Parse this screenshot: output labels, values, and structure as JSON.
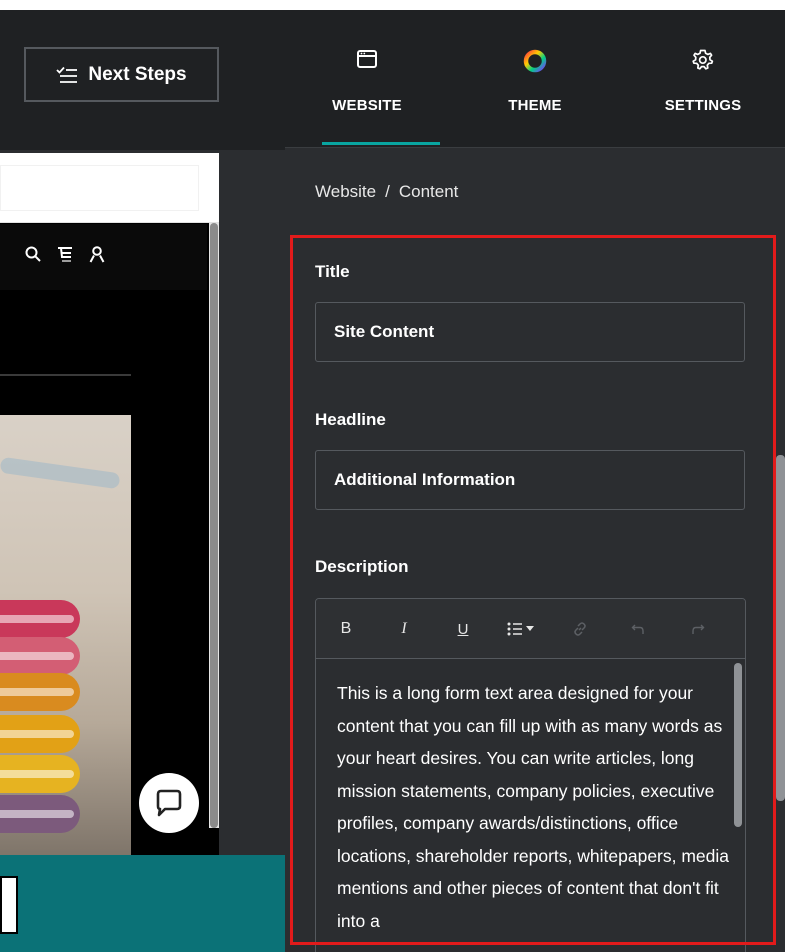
{
  "topbar": {
    "next_steps_label": "Next Steps"
  },
  "preview": {
    "icons": [
      "search-icon",
      "cart-icon",
      "user-icon"
    ],
    "chat_icon": "chat-icon"
  },
  "panel": {
    "tabs": [
      {
        "label": "WEBSITE",
        "icon": "browser-window-icon",
        "active": true
      },
      {
        "label": "THEME",
        "icon": "color-wheel-icon",
        "active": false
      },
      {
        "label": "SETTINGS",
        "icon": "gear-icon",
        "active": false
      }
    ],
    "breadcrumb": {
      "root": "Website",
      "separator": "/",
      "current": "Content"
    },
    "fields": {
      "title": {
        "label": "Title",
        "value": "Site Content"
      },
      "headline": {
        "label": "Headline",
        "value": "Additional Information"
      },
      "description": {
        "label": "Description",
        "toolbar": [
          {
            "label": "B",
            "name": "bold-button",
            "enabled": true
          },
          {
            "label": "I",
            "name": "italic-button",
            "enabled": true
          },
          {
            "label": "U",
            "name": "underline-button",
            "enabled": true
          },
          {
            "label": "list",
            "name": "list-dropdown-button",
            "enabled": true
          },
          {
            "label": "link",
            "name": "link-button",
            "enabled": false
          },
          {
            "label": "undo",
            "name": "undo-button",
            "enabled": false
          },
          {
            "label": "redo",
            "name": "redo-button",
            "enabled": false
          }
        ],
        "value": "This is a long form text area designed for your content that you can fill up with as many words as your heart desires. You can write articles, long mission statements, company policies, executive profiles, company awards/distinctions, office locations, shareholder reports, whitepapers, media mentions and other pieces of content that don't fit into a"
      }
    }
  },
  "colors": {
    "panel_bg": "#2b2d30",
    "tab_active_underline": "#09a5a0",
    "highlight_border": "#e21b1b",
    "teal_band": "#0b7277"
  }
}
